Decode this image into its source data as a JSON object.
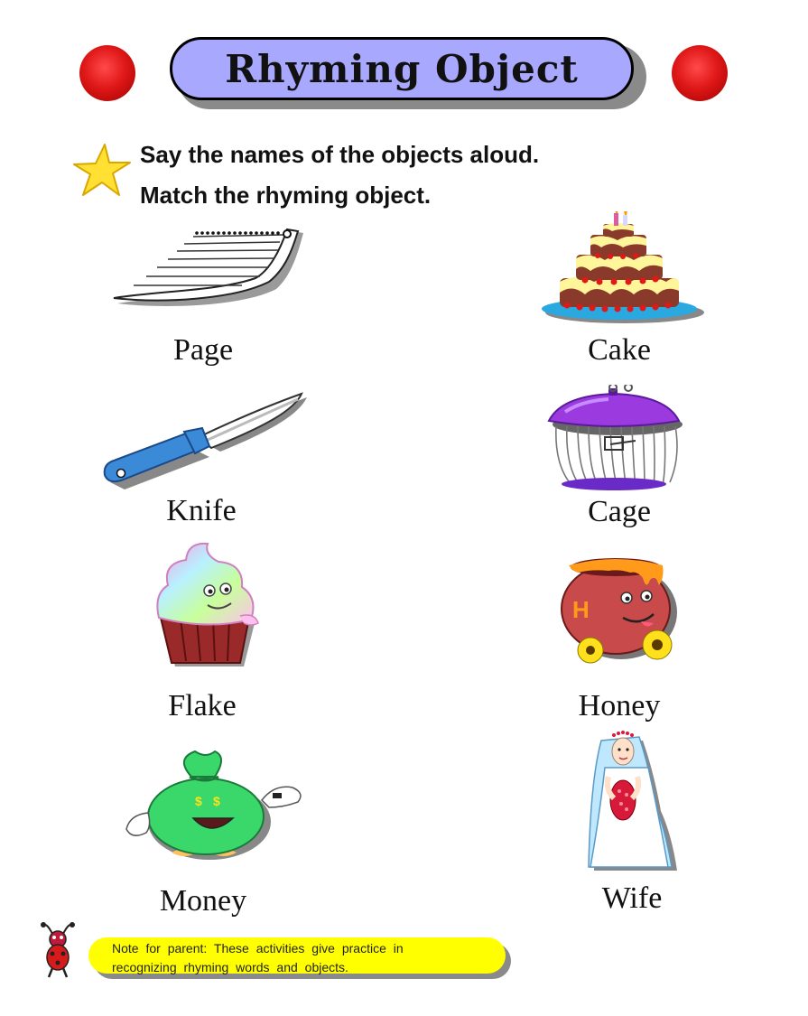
{
  "title": "Rhyming Object",
  "instructions": {
    "line1": "Say the names of the objects aloud.",
    "line2": "Match the rhyming object."
  },
  "left_items": [
    {
      "label": "Page",
      "icon": "page-icon"
    },
    {
      "label": "Knife",
      "icon": "knife-icon"
    },
    {
      "label": "Flake",
      "icon": "cupcake-icon"
    },
    {
      "label": "Money",
      "icon": "money-bag-icon"
    }
  ],
  "right_items": [
    {
      "label": "Cake",
      "icon": "cake-icon"
    },
    {
      "label": "Cage",
      "icon": "cage-icon"
    },
    {
      "label": "Honey",
      "icon": "honey-pot-icon"
    },
    {
      "label": "Wife",
      "icon": "bride-icon"
    }
  ],
  "note": {
    "line1": "Note for parent: These activities give practice in",
    "line2": "recognizing rhyming words and objects."
  },
  "colors": {
    "title_pill": "#a8a8ff",
    "ball": "#e01818",
    "note_bg": "#ffff00",
    "star": "#ffe033"
  }
}
